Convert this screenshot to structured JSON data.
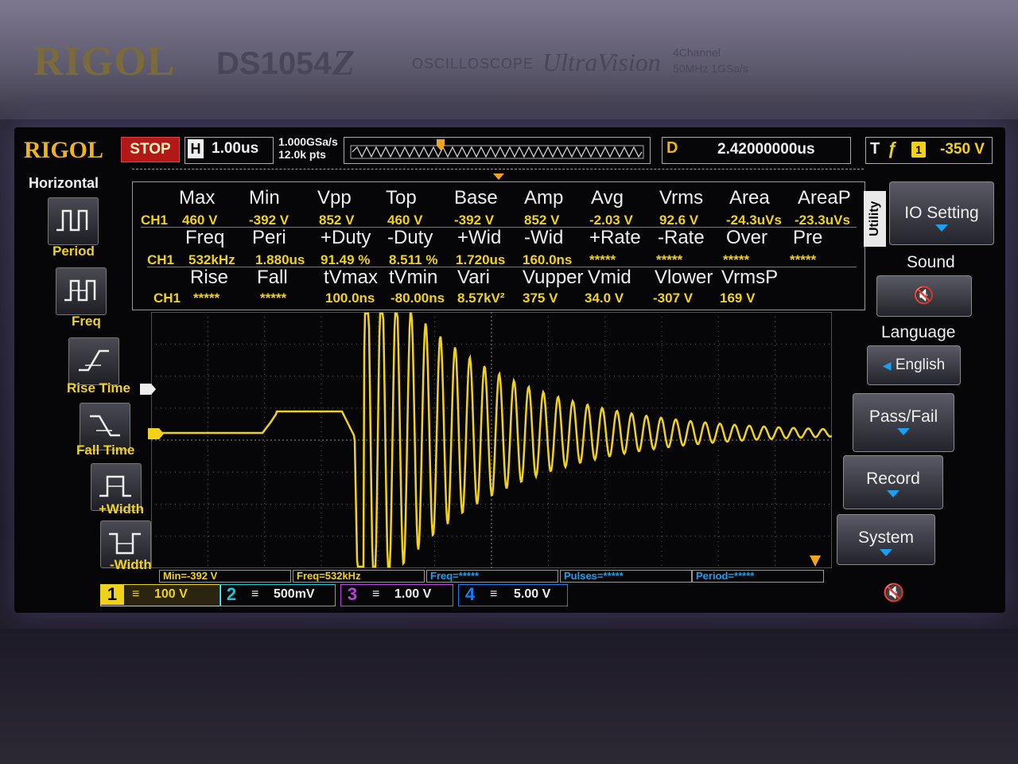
{
  "device": {
    "brand": "RIGOL",
    "model": "DS1054",
    "model_badge": "Z",
    "type": "OSCILLOSCOPE",
    "technology": "UltraVision",
    "spec_channels": "4Channel",
    "spec_rate": "50MHz 1GSa/s"
  },
  "status": {
    "logo": "RIGOL",
    "run_state": "STOP",
    "h_label": "H",
    "h_scale": "1.00us",
    "sample_rate": "1.000GSa/s",
    "memory_depth": "12.0k pts",
    "delay_label": "D",
    "delay": "2.42000000us",
    "trigger_label": "T",
    "trigger_source": "1",
    "trigger_level": "-350 V"
  },
  "left_menu": {
    "title": "Horizontal",
    "items": [
      {
        "label": "Period",
        "icon": "period-icon"
      },
      {
        "label": "Freq",
        "icon": "freq-icon"
      },
      {
        "label": "Rise Time",
        "icon": "rise-time-icon"
      },
      {
        "label": "Fall Time",
        "icon": "fall-time-icon"
      },
      {
        "label": "+Width",
        "icon": "pos-width-icon"
      },
      {
        "label": "-Width",
        "icon": "neg-width-icon"
      }
    ]
  },
  "measurements": {
    "channel": "CH1",
    "rows": [
      {
        "headers": [
          "Max",
          "Min",
          "Vpp",
          "Top",
          "Base",
          "Amp",
          "Avg",
          "Vrms",
          "Area",
          "AreaP"
        ],
        "values": [
          "460 V",
          "-392 V",
          "852 V",
          "460 V",
          "-392 V",
          "852 V",
          "-2.03 V",
          "92.6 V",
          "-24.3uVs",
          "-23.3uVs"
        ]
      },
      {
        "headers": [
          "Freq",
          "Peri",
          "+Duty",
          "-Duty",
          "+Wid",
          "-Wid",
          "+Rate",
          "-Rate",
          "Over",
          "Pre"
        ],
        "values": [
          "532kHz",
          "1.880us",
          "91.49 %",
          "8.511 %",
          "1.720us",
          "160.0ns",
          "*****",
          "*****",
          "*****",
          "*****"
        ]
      },
      {
        "headers": [
          "Rise",
          "Fall",
          "tVmax",
          "tVmin",
          "Vari",
          "Vupper",
          "Vmid",
          "Vlower",
          "VrmsP"
        ],
        "values": [
          "*****",
          "*****",
          "100.0ns",
          "-80.00ns",
          "8.57kV²",
          "375 V",
          "34.0 V",
          "-307 V",
          "169 V"
        ]
      }
    ]
  },
  "right_menu": {
    "tab": "Utility",
    "io_setting": "IO Setting",
    "sound_title": "Sound",
    "language_title": "Language",
    "language_value": "English",
    "pass_fail": "Pass/Fail",
    "record": "Record",
    "system": "System"
  },
  "info_bar": {
    "min": "Min=-392 V",
    "freq1": "Freq=532kHz",
    "freq2": "Freq=*****",
    "pulses": "Pulses=*****",
    "period": "Period=*****"
  },
  "channels": [
    {
      "num": "1",
      "scale": "100 V",
      "color": "#f0d21a"
    },
    {
      "num": "2",
      "scale": "500mV",
      "color": "#19c8d8"
    },
    {
      "num": "3",
      "scale": "1.00 V",
      "color": "#c040e0"
    },
    {
      "num": "4",
      "scale": "5.00 V",
      "color": "#1a7af0"
    }
  ]
}
